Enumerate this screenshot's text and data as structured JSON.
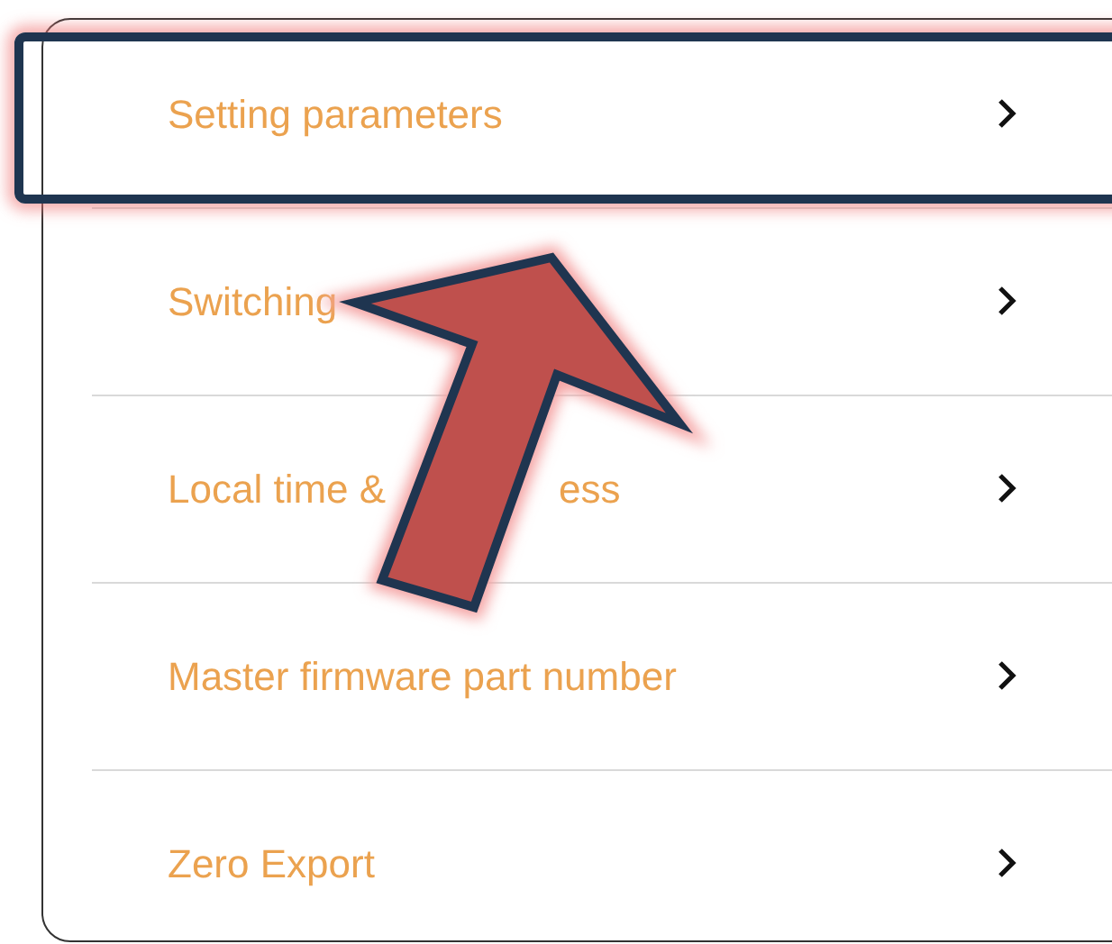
{
  "menu_items": [
    {
      "label_parts": [
        "Setting parameters"
      ],
      "highlighted": true
    },
    {
      "label_parts": [
        "Switching"
      ],
      "highlighted": false
    },
    {
      "label_parts": [
        "Local time &",
        "ess"
      ],
      "highlighted": false
    },
    {
      "label_parts": [
        "Master firmware part number"
      ],
      "highlighted": false
    },
    {
      "label_parts": [
        "Zero Export"
      ],
      "highlighted": false
    }
  ]
}
